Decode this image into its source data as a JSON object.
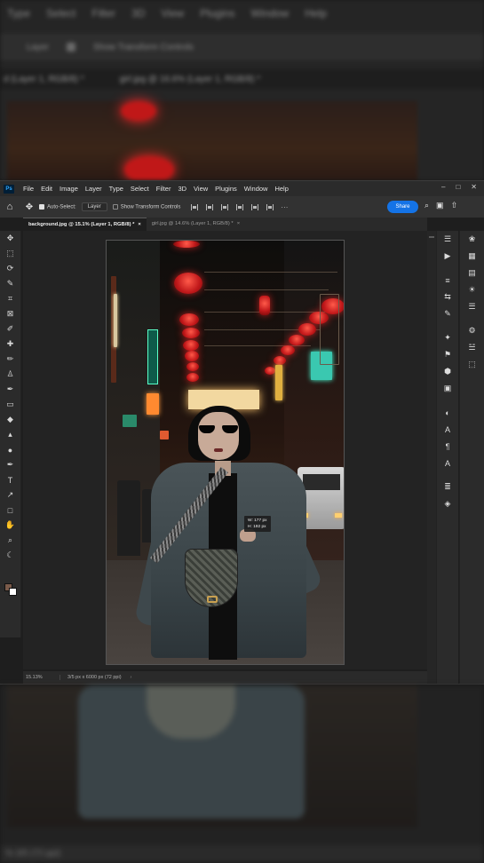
{
  "background_top": {
    "menu": [
      "Type",
      "Select",
      "Filter",
      "3D",
      "View",
      "Plugins",
      "Window",
      "Help"
    ],
    "layer_label": "Layer",
    "transform_label": "Show Transform Controls",
    "tab1": "d (Layer 1, RGB/8) *",
    "tab2": "girl.jpg @ 16.6% (Layer 1, RGB/8) *"
  },
  "background_bottom": {
    "status": "% 3/5 (72 ppi)"
  },
  "menubar": {
    "logo": "Ps",
    "items": [
      "File",
      "Edit",
      "Image",
      "Layer",
      "Type",
      "Select",
      "Filter",
      "3D",
      "View",
      "Plugins",
      "Window",
      "Help"
    ],
    "window_controls": [
      "–",
      "□",
      "✕"
    ]
  },
  "options": {
    "auto_select_label": "Auto-Select:",
    "auto_select_value": "Layer",
    "transform_label": "Show Transform Controls",
    "more": "···",
    "share_label": "Share"
  },
  "tabs": [
    {
      "label": "background.jpg @ 15.1% (Layer 1, RGB/8) *",
      "close": "×"
    },
    {
      "label": "girl.jpg @ 14.6% (Layer 1, RGB/8) *",
      "close": "×"
    }
  ],
  "canvas": {
    "measure_w": "W: 177 px",
    "measure_h": "H: 192 px"
  },
  "status": {
    "zoom": "15.13%",
    "dims": "3/5 px x 6000 px (72 ppi)",
    "arrow": "›"
  },
  "tools": [
    {
      "name": "move-tool-icon",
      "glyph": "✥"
    },
    {
      "name": "marquee-tool-icon",
      "glyph": "⬚"
    },
    {
      "name": "lasso-tool-icon",
      "glyph": "⟳"
    },
    {
      "name": "quick-select-tool-icon",
      "glyph": "✎"
    },
    {
      "name": "crop-tool-icon",
      "glyph": "⌗"
    },
    {
      "name": "frame-tool-icon",
      "glyph": "⊠"
    },
    {
      "name": "eyedropper-tool-icon",
      "glyph": "✐"
    },
    {
      "name": "healing-tool-icon",
      "glyph": "✚"
    },
    {
      "name": "brush-tool-icon",
      "glyph": "✏"
    },
    {
      "name": "stamp-tool-icon",
      "glyph": "♙"
    },
    {
      "name": "history-brush-icon",
      "glyph": "✒"
    },
    {
      "name": "eraser-tool-icon",
      "glyph": "▭"
    },
    {
      "name": "bucket-tool-icon",
      "glyph": "◆"
    },
    {
      "name": "blur-tool-icon",
      "glyph": "▴"
    },
    {
      "name": "dodge-tool-icon",
      "glyph": "●"
    },
    {
      "name": "pen-tool-icon",
      "glyph": "✒"
    },
    {
      "name": "type-tool-icon",
      "glyph": "T"
    },
    {
      "name": "path-select-tool-icon",
      "glyph": "↗"
    },
    {
      "name": "shape-tool-icon",
      "glyph": "□"
    },
    {
      "name": "hand-tool-icon",
      "glyph": "✋"
    },
    {
      "name": "zoom-tool-icon",
      "glyph": "⌕"
    },
    {
      "name": "edit-toolbar-icon",
      "glyph": "☾"
    }
  ],
  "dock_icons": [
    "☰",
    "▶",
    "≡",
    "⇆",
    "✎",
    "✦",
    "⚑",
    "⬢",
    "▣",
    "◐",
    "A",
    "¶",
    "Α",
    "≣",
    "◈"
  ],
  "dock2_icons": [
    "❀",
    "▦",
    "▤",
    "☀",
    "☰",
    "⚙",
    "☱",
    "⬚"
  ]
}
